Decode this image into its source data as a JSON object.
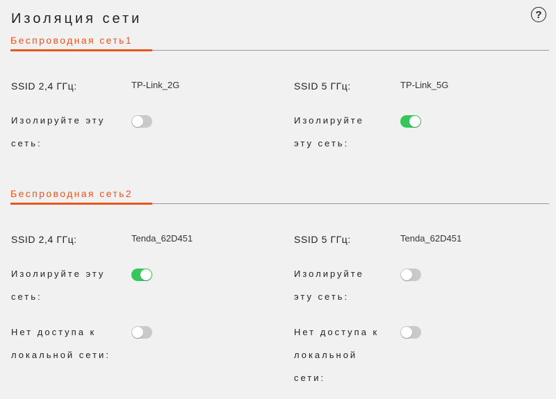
{
  "page": {
    "title": "Изоляция сети",
    "help_icon": "question-circle-icon"
  },
  "colors": {
    "accent": "#e8551d",
    "toggle_on": "#35c759",
    "toggle_off": "#c9c9c9"
  },
  "sections": [
    {
      "tab_label": "Беспроводная сеть1",
      "left": {
        "ssid_label": "SSID 2,4 ГГц:",
        "ssid_value": "TP-Link_2G",
        "isolate_label_line1": "Изолируйте эту",
        "isolate_label_line2": "сеть:",
        "isolate_on": false
      },
      "right": {
        "ssid_label": "SSID 5 ГГц:",
        "ssid_value": "TP-Link_5G",
        "isolate_label_line1": "Изолируйте",
        "isolate_label_line2": "эту сеть:",
        "isolate_on": true
      }
    },
    {
      "tab_label": "Беспроводная сеть2",
      "left": {
        "ssid_label": "SSID 2,4 ГГц:",
        "ssid_value": "Tenda_62D451",
        "isolate_label_line1": "Изолируйте эту",
        "isolate_label_line2": "сеть:",
        "isolate_on": true,
        "local_label_line1": "Нет доступа к",
        "local_label_line2": "локальной сети:",
        "local_on": false
      },
      "right": {
        "ssid_label": "SSID 5 ГГц:",
        "ssid_value": "Tenda_62D451",
        "isolate_label_line1": "Изолируйте",
        "isolate_label_line2": "эту сеть:",
        "isolate_on": false,
        "local_label_line1": "Нет доступа к",
        "local_label_line2": "локальной",
        "local_label_line3": "сети:",
        "local_on": false
      }
    }
  ]
}
